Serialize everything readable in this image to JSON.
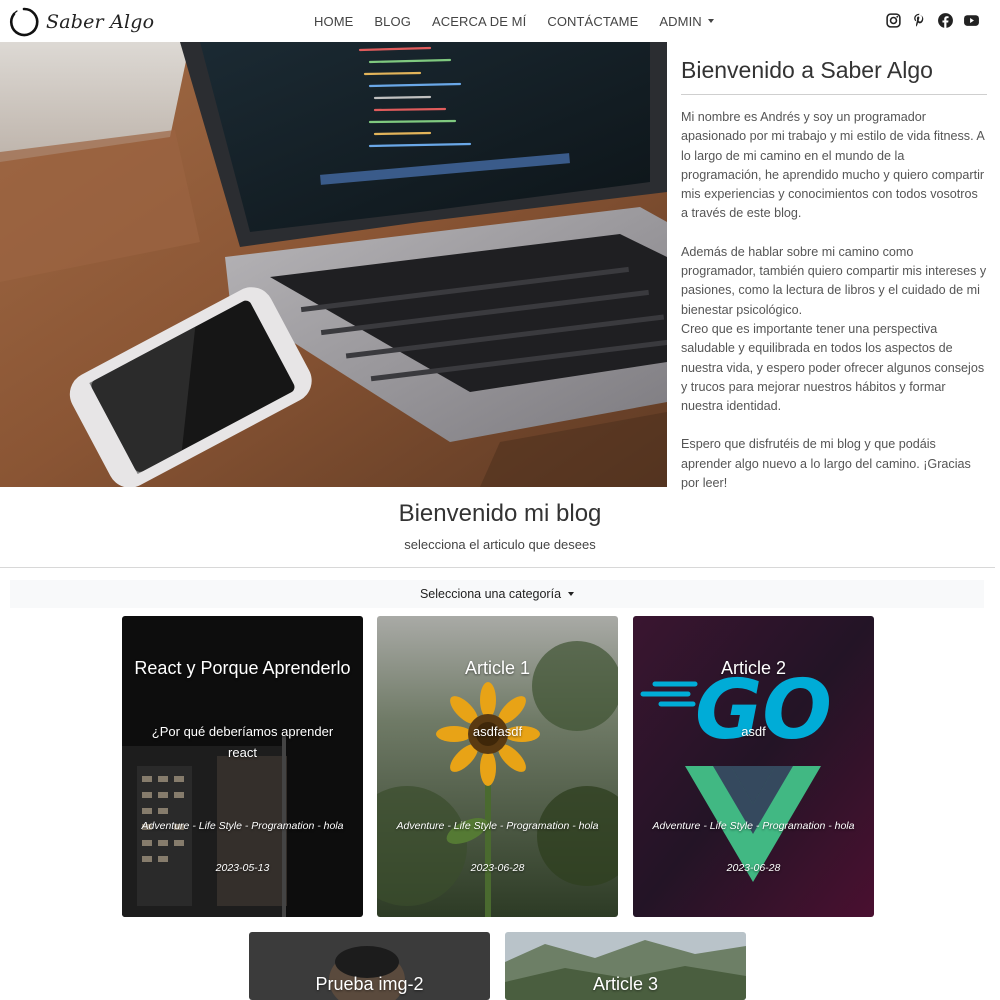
{
  "brand": {
    "name": "Saber Algo",
    "logo_icon": "circle-logo-icon"
  },
  "nav": {
    "items": [
      {
        "label": "HOME"
      },
      {
        "label": "BLOG"
      },
      {
        "label": "ACERCA DE MÍ"
      },
      {
        "label": "CONTÁCTAME"
      }
    ],
    "admin_label": "ADMIN"
  },
  "social": [
    "instagram-icon",
    "pinterest-icon",
    "facebook-icon",
    "youtube-icon"
  ],
  "hero": {
    "title": "Bienvenido a Saber Algo",
    "paragraphs": [
      "Mi nombre es Andrés y soy un programador apasionado por mi trabajo y mi estilo de vida fitness. A lo largo de mi camino en el mundo de la programación, he aprendido mucho y quiero compartir mis experiencias y conocimientos con todos vosotros a través de este blog.",
      "Además de hablar sobre mi camino como programador, también quiero compartir mis intereses y pasiones, como la lectura de libros y el cuidado de mi bienestar psicológico.",
      "Creo que es importante tener una perspectiva saludable y equilibrada en todos los aspectos de nuestra vida, y espero poder ofrecer algunos consejos y trucos para mejorar nuestros hábitos y formar nuestra identidad.",
      "Espero que disfrutéis de mi blog y que podáis aprender algo nuevo a lo largo del camino. ¡Gracias por leer!"
    ]
  },
  "blog": {
    "title": "Bienvenido mi blog",
    "subtitle": "selecciona el articulo que desees",
    "category_label": "Selecciona una categoría"
  },
  "cards": [
    {
      "title": "React y Porque Aprenderlo",
      "description": "¿Por qué deberíamos aprender react",
      "tags": "Adventure - Life Style - Programation - hola",
      "date": "2023-05-13"
    },
    {
      "title": "Article 1",
      "description": "asdfasdf",
      "tags": "Adventure - Life Style - Programation - hola",
      "date": "2023-06-28"
    },
    {
      "title": "Article 2",
      "description": "asdf",
      "tags": "Adventure - Life Style - Programation - hola",
      "date": "2023-06-28",
      "logo_text": "GO"
    },
    {
      "title": "Prueba img-2"
    },
    {
      "title": "Article 3"
    }
  ],
  "colors": {
    "go_blue": "#00acd7",
    "vue_green": "#41b883",
    "vue_dark": "#35495e"
  }
}
